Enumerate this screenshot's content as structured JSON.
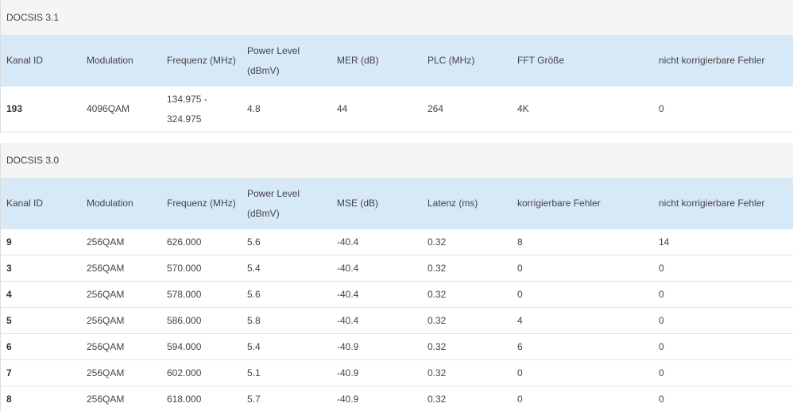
{
  "docsis31": {
    "title": "DOCSIS 3.1",
    "headers": [
      "Kanal ID",
      "Modulation",
      "Frequenz (MHz)",
      "Power Level (dBmV)",
      "MER (dB)",
      "PLC (MHz)",
      "FFT Größe",
      "nicht korrigierbare Fehler"
    ],
    "rows": [
      [
        "193",
        "4096QAM",
        "134.975 - 324.975",
        "4.8",
        "44",
        "264",
        "4K",
        "0"
      ]
    ]
  },
  "docsis30": {
    "title": "DOCSIS 3.0",
    "headers": [
      "Kanal ID",
      "Modulation",
      "Frequenz (MHz)",
      "Power Level (dBmV)",
      "MSE (dB)",
      "Latenz (ms)",
      "korrigierbare Fehler",
      "nicht korrigierbare Fehler"
    ],
    "rows": [
      [
        "9",
        "256QAM",
        "626.000",
        "5.6",
        "-40.4",
        "0.32",
        "8",
        "14"
      ],
      [
        "3",
        "256QAM",
        "570.000",
        "5.4",
        "-40.4",
        "0.32",
        "0",
        "0"
      ],
      [
        "4",
        "256QAM",
        "578.000",
        "5.6",
        "-40.4",
        "0.32",
        "0",
        "0"
      ],
      [
        "5",
        "256QAM",
        "586.000",
        "5.8",
        "-40.4",
        "0.32",
        "4",
        "0"
      ],
      [
        "6",
        "256QAM",
        "594.000",
        "5.4",
        "-40.9",
        "0.32",
        "6",
        "0"
      ],
      [
        "7",
        "256QAM",
        "602.000",
        "5.1",
        "-40.9",
        "0.32",
        "0",
        "0"
      ],
      [
        "8",
        "256QAM",
        "618.000",
        "5.7",
        "-40.9",
        "0.32",
        "0",
        "0"
      ]
    ]
  }
}
